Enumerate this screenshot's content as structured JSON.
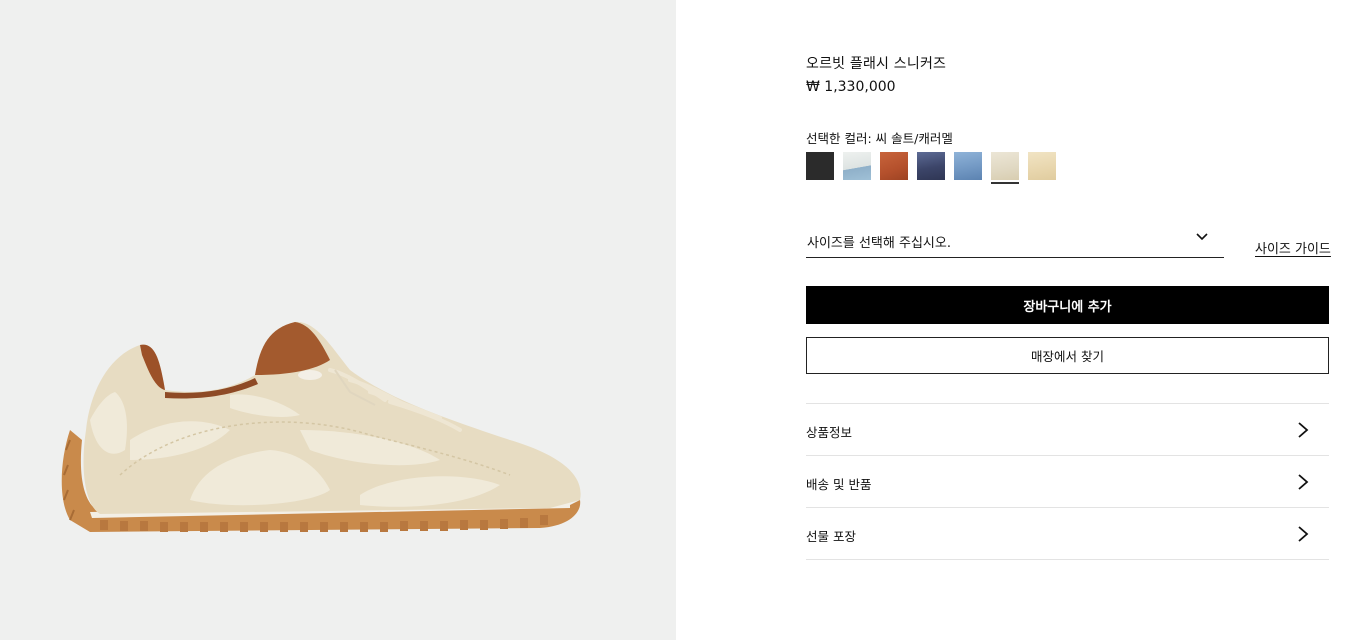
{
  "product": {
    "name": "오르빗 플래시 스니커즈",
    "price": "₩ 1,330,000",
    "image_alt": "sneaker-product-image"
  },
  "colors": {
    "label": "선택한 컬러: 씨 솔트/캐러멜",
    "swatches": [
      {
        "name": "black",
        "color": "#2a2a2a",
        "selected": false
      },
      {
        "name": "light-blue",
        "color": "#c9d6df",
        "selected": false
      },
      {
        "name": "rust",
        "color": "#b44f2c",
        "selected": false
      },
      {
        "name": "navy",
        "color": "#3b4466",
        "selected": false
      },
      {
        "name": "sky-blue",
        "color": "#7da1c9",
        "selected": false
      },
      {
        "name": "sea-salt-caramel",
        "color": "#e3dcc7",
        "selected": true
      },
      {
        "name": "sand",
        "color": "#ead9b4",
        "selected": false
      }
    ]
  },
  "size": {
    "placeholder": "사이즈를 선택해 주십시오.",
    "guide_label": "사이즈 가이드"
  },
  "actions": {
    "add_to_cart": "장바구니에 추가",
    "find_in_store": "매장에서 찾기"
  },
  "accordion": {
    "items": [
      {
        "label": "상품정보"
      },
      {
        "label": "배송 및 반품"
      },
      {
        "label": "선물 포장"
      }
    ]
  },
  "theme": {
    "gallery_bg": "#eff0ef",
    "primary": "#000000",
    "divider": "#e3e3e3"
  }
}
